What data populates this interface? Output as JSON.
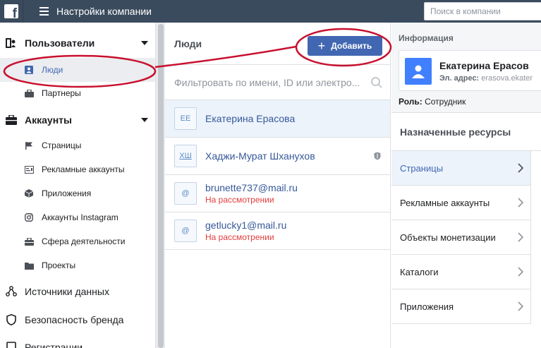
{
  "topbar": {
    "logo_letter": "f",
    "title": "Настройки компании",
    "search_placeholder": "Поиск в компании"
  },
  "sidebar": {
    "sections": [
      {
        "label": "Пользователи",
        "icon": "users-icon",
        "expanded": true
      },
      {
        "label": "Аккаунты",
        "icon": "briefcase-icon",
        "expanded": true
      },
      {
        "label": "Источники данных",
        "icon": "data-sources-icon",
        "expanded": false
      },
      {
        "label": "Безопасность бренда",
        "icon": "shield-icon",
        "expanded": false
      },
      {
        "label": "Регистрации",
        "icon": "registrations-icon",
        "expanded": false
      }
    ],
    "user_items": [
      {
        "label": "Люди",
        "icon": "person-icon",
        "active": true
      },
      {
        "label": "Партнеры",
        "icon": "partners-icon",
        "active": false
      }
    ],
    "account_items": [
      {
        "label": "Страницы",
        "icon": "flag-icon"
      },
      {
        "label": "Рекламные аккаунты",
        "icon": "ad-account-icon"
      },
      {
        "label": "Приложения",
        "icon": "cube-icon"
      },
      {
        "label": "Аккаунты Instagram",
        "icon": "instagram-icon"
      },
      {
        "label": "Сфера деятельности",
        "icon": "briefcase-small-icon"
      },
      {
        "label": "Проекты",
        "icon": "folder-icon"
      }
    ]
  },
  "people": {
    "title": "Люди",
    "add_button": "Добавить",
    "filter_placeholder": "Фильтровать по имени, ID или электро...",
    "list": [
      {
        "initials": "ЕЕ",
        "name": "Екатерина Ерасова",
        "status": "",
        "selected": true
      },
      {
        "initials": "ХШ",
        "name": "Хаджи-Мурат Шханухов",
        "status": "",
        "selected": false,
        "badge": "shield-icon"
      },
      {
        "initials": "@",
        "name": "brunette737@mail.ru",
        "status": "На рассмотрении",
        "selected": false
      },
      {
        "initials": "@",
        "name": "getlucky1@mail.ru",
        "status": "На рассмотрении",
        "selected": false
      }
    ]
  },
  "info": {
    "label": "Информация",
    "name": "Екатерина Ерасов",
    "email_label": "Эл. адрес:",
    "email_value": "erasova.ekater",
    "role_label": "Роль:",
    "role_value": "Сотрудник"
  },
  "resources": {
    "title": "Назначенные ресурсы",
    "items": [
      {
        "label": "Страницы",
        "selected": true
      },
      {
        "label": "Рекламные аккаунты",
        "selected": false
      },
      {
        "label": "Объекты монетизации",
        "selected": false
      },
      {
        "label": "Каталоги",
        "selected": false
      },
      {
        "label": "Приложения",
        "selected": false
      }
    ]
  },
  "colors": {
    "topbar": "#3b4b5e",
    "accent": "#4267b2",
    "annotation": "#c8102e",
    "pending": "#e33c3c"
  }
}
